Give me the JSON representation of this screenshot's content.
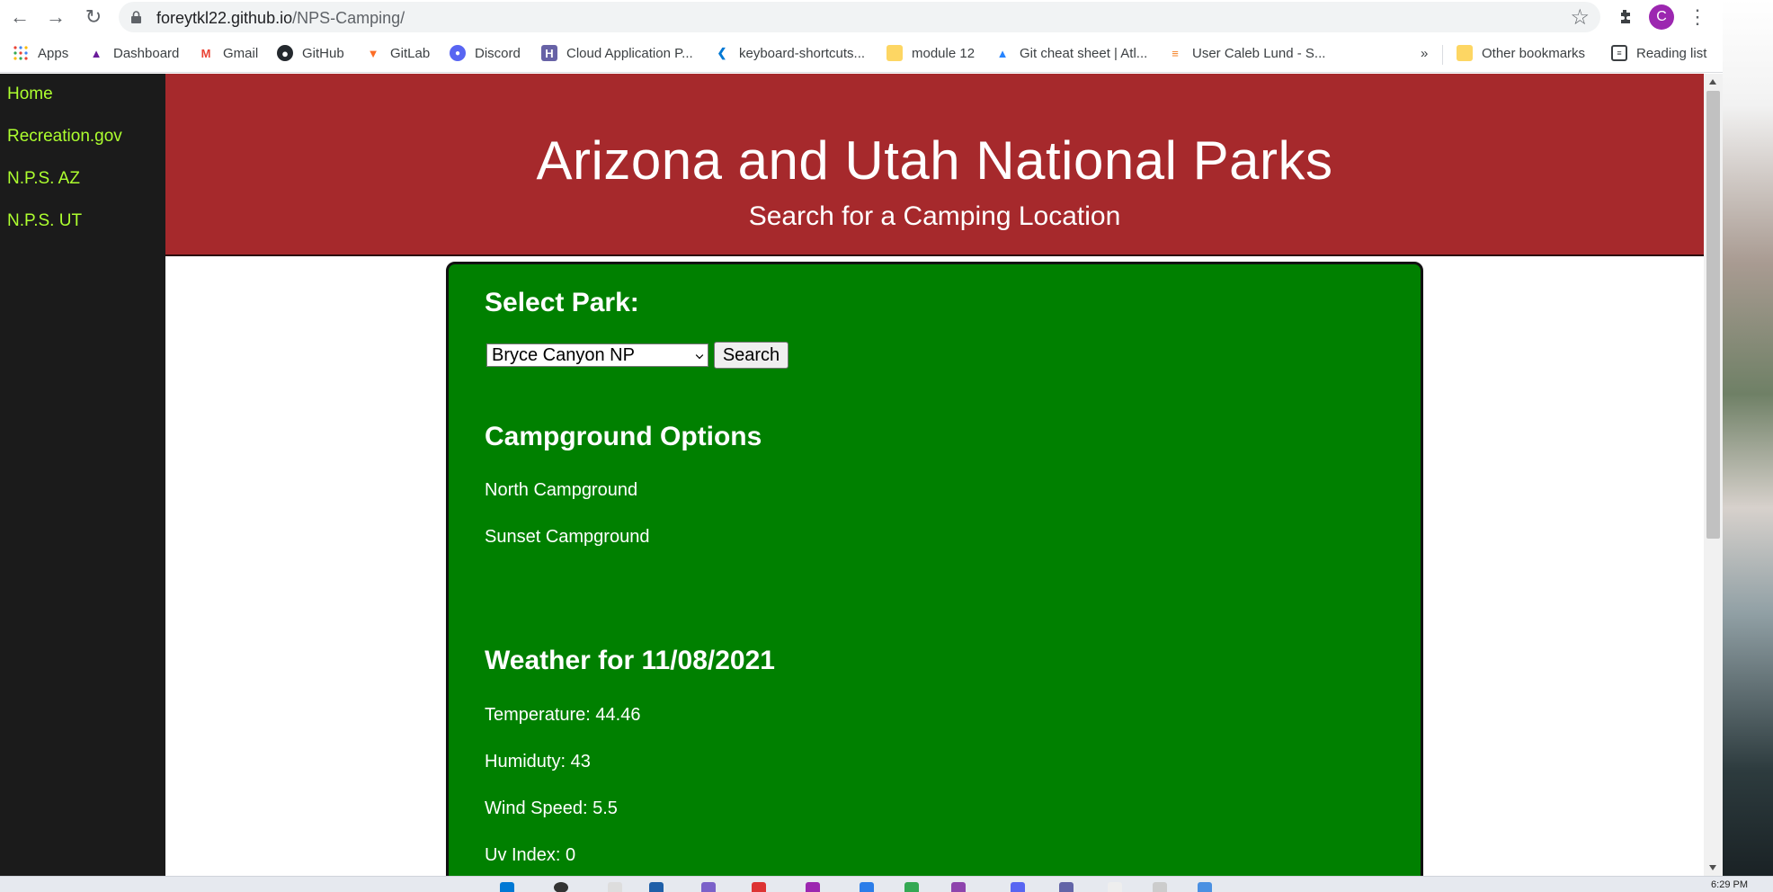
{
  "browser": {
    "url_host": "foreytkl22.github.io",
    "url_path": "/NPS-Camping/",
    "profile_initial": "C",
    "bookmarks": [
      {
        "label": "Apps",
        "icon": "apps-grid-icon"
      },
      {
        "label": "Dashboard",
        "icon": "dashboard-icon"
      },
      {
        "label": "Gmail",
        "icon": "gmail-icon"
      },
      {
        "label": "GitHub",
        "icon": "github-icon"
      },
      {
        "label": "GitLab",
        "icon": "gitlab-icon"
      },
      {
        "label": "Discord",
        "icon": "discord-icon"
      },
      {
        "label": "Cloud Application P...",
        "icon": "heroku-icon"
      },
      {
        "label": "keyboard-shortcuts...",
        "icon": "vscode-icon"
      },
      {
        "label": "module 12",
        "icon": "folder-icon"
      },
      {
        "label": "Git cheat sheet | Atl...",
        "icon": "atlassian-icon"
      },
      {
        "label": "User Caleb Lund - S...",
        "icon": "stackoverflow-icon"
      }
    ],
    "more_bookmarks": "»",
    "other_bookmarks": "Other bookmarks",
    "reading_list": "Reading list"
  },
  "sidebar": {
    "links": [
      "Home",
      "Recreation.gov",
      "N.P.S. AZ",
      "N.P.S. UT"
    ]
  },
  "header": {
    "title": "Arizona and Utah National Parks",
    "subtitle": "Search for a Camping Location"
  },
  "park_search": {
    "heading": "Select Park:",
    "selected_park": "Bryce Canyon NP",
    "search_label": "Search"
  },
  "campgrounds": {
    "heading": "Campground Options",
    "items": [
      "North Campground",
      "Sunset Campground"
    ]
  },
  "weather": {
    "heading": "Weather for 11/08/2021",
    "temperature": "Temperature: 44.46",
    "humidity": "Humiduty: 43",
    "wind_speed": "Wind Speed: 5.5",
    "uv_index": "Uv Index: 0"
  },
  "system": {
    "clock": "6:29 PM"
  },
  "colors": {
    "sidebar_bg": "#1b1b1b",
    "sidebar_link": "#adff2f",
    "header_bg": "#a6292c",
    "content_bg": "#008000"
  }
}
